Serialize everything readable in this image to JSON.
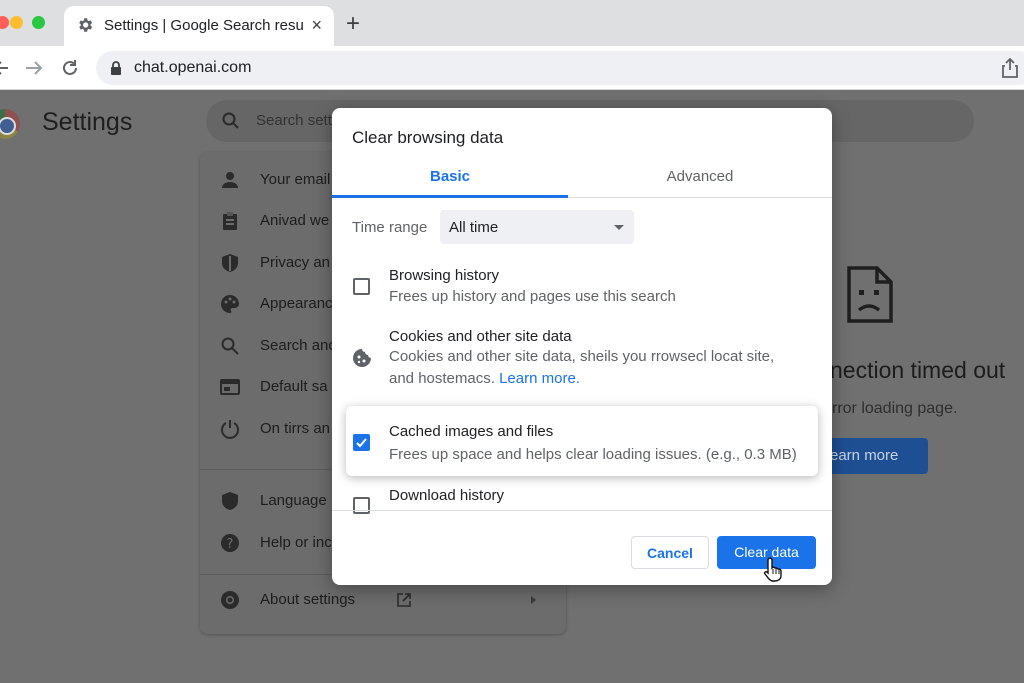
{
  "browser": {
    "tab_title": "Settings | Google Search results",
    "new_tab_label": "+",
    "close_label": "×",
    "url": "chat.openai.com",
    "traffic_colors": [
      "#ff5f57",
      "#febc2e",
      "#28c840"
    ]
  },
  "settings": {
    "title": "Settings",
    "search_placeholder": "Search settings",
    "menu": [
      {
        "label": "Your email",
        "icon": "person-icon"
      },
      {
        "label": "Anivad we",
        "icon": "clipboard-icon"
      },
      {
        "label": "Privacy an",
        "icon": "shield-icon"
      },
      {
        "label": "Appearanc",
        "icon": "palette-icon"
      },
      {
        "label": "Search anc",
        "icon": "search-icon"
      },
      {
        "label": "Default sa",
        "icon": "browser-window-icon"
      },
      {
        "label": "On tirrs an",
        "icon": "power-icon"
      },
      {
        "label": "Language",
        "icon": "shield-filled-icon"
      },
      {
        "label": "Help or inc",
        "icon": "help-icon"
      },
      {
        "label": "About settings",
        "icon": "chrome-icon"
      }
    ]
  },
  "error_page": {
    "title": "nection timed out",
    "subtitle": "rror loading page.",
    "button": "earn more"
  },
  "dialog": {
    "title": "Clear browsing data",
    "tabs": {
      "basic": "Basic",
      "advanced": "Advanced"
    },
    "time_range_label": "Time range",
    "time_range_value": "All time",
    "options": {
      "browsing": {
        "title": "Browsing history",
        "desc": "Frees up history and pages use this search",
        "checked": false
      },
      "cookies": {
        "title": "Cookies and other site data",
        "desc1": "Cookies and other site data, sheils you rrowsecl locat site,",
        "desc2": "and hostemacs.",
        "link": "Learn more.",
        "icon": "cookie-icon"
      },
      "cached": {
        "title": "Cached images and files",
        "desc": "Frees up space and helps clear loading issues. (e.g., 0.3 MB)",
        "checked": true
      },
      "download": {
        "title": "Download history",
        "checked": false
      }
    },
    "cancel": "Cancel",
    "clear": "Clear data"
  },
  "colors": {
    "accent": "#1a73e8"
  }
}
